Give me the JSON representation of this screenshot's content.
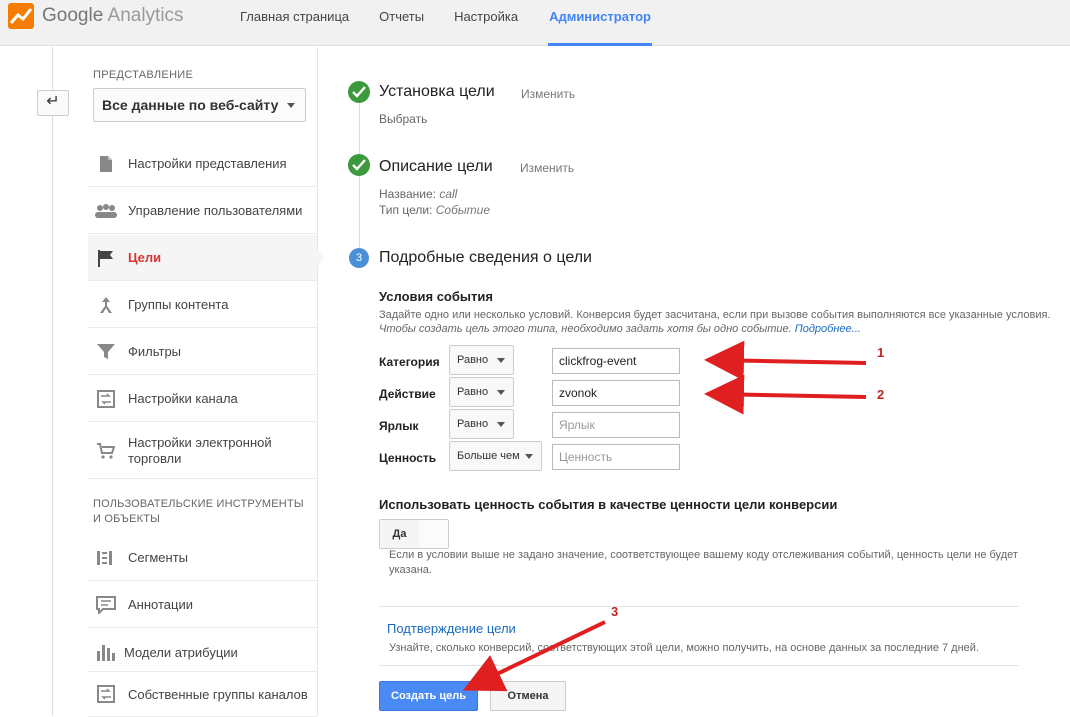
{
  "header": {
    "logo_google": "Google",
    "logo_analytics": "Analytics",
    "nav": [
      "Главная страница",
      "Отчеты",
      "Настройка",
      "Администратор"
    ]
  },
  "sidebar": {
    "view_label": "ПРЕДСТАВЛЕНИЕ",
    "view_select": "Все данные по веб-сайту",
    "items": [
      {
        "label": "Настройки представления",
        "icon": "page-icon"
      },
      {
        "label": "Управление пользователями",
        "icon": "people-icon"
      },
      {
        "label": "Цели",
        "icon": "flag-icon"
      },
      {
        "label": "Группы контента",
        "icon": "branch-icon"
      },
      {
        "label": "Фильтры",
        "icon": "filter-icon"
      },
      {
        "label": "Настройки канала",
        "icon": "channel-icon"
      },
      {
        "label": "Настройки электронной торговли",
        "icon": "cart-icon"
      }
    ],
    "tools_title": "ПОЛЬЗОВАТЕЛЬСКИЕ ИНСТРУМЕНТЫ И ОБЪЕКТЫ",
    "tools": [
      {
        "label": "Сегменты",
        "icon": "segments-icon"
      },
      {
        "label": "Аннотации",
        "icon": "annotation-icon"
      },
      {
        "label": "Модели атрибуции",
        "icon": "bars-icon"
      },
      {
        "label": "Собственные группы каналов",
        "icon": "channel-groups-icon"
      }
    ]
  },
  "steps": {
    "s1_title": "Установка цели",
    "s1_edit": "Изменить",
    "s1_value": "Выбрать",
    "s2_title": "Описание цели",
    "s2_edit": "Изменить",
    "s2_name_label": "Название:",
    "s2_name_value": "call",
    "s2_type_label": "Тип цели:",
    "s2_type_value": "Событие",
    "s3_num": "3",
    "s3_title": "Подробные сведения о цели"
  },
  "conditions": {
    "title": "Условия события",
    "desc": "Задайте одно или несколько условий. Конверсия будет засчитана, если при вызове события выполняются все указанные условия.",
    "desc_italic": "Чтобы создать цель этого типа, необходимо задать хотя бы одно событие.",
    "more_link": "Подробнее...",
    "rows": [
      {
        "label": "Категория",
        "op": "Равно",
        "value": "clickfrog-event",
        "placeholder": ""
      },
      {
        "label": "Действие",
        "op": "Равно",
        "value": "zvonok",
        "placeholder": ""
      },
      {
        "label": "Ярлык",
        "op": "Равно",
        "value": "",
        "placeholder": "Ярлык"
      },
      {
        "label": "Ценность",
        "op": "Больше чем",
        "value": "",
        "placeholder": "Ценность"
      }
    ]
  },
  "use_value": {
    "title": "Использовать ценность события в качестве ценности цели конверсии",
    "toggle_label": "Да",
    "desc": "Если в условии выше не задано значение, соответствующее вашему коду отслеживания событий, ценность цели не будет указана."
  },
  "verify": {
    "link": "Подтверждение цели",
    "desc": "Узнайте, сколько конверсий, соответствующих этой цели, можно получить, на основе данных за последние 7 дней."
  },
  "actions": {
    "create": "Создать цель",
    "cancel": "Отмена"
  },
  "annotations": [
    "1",
    "2",
    "3"
  ],
  "colors": {
    "accent": "#4285f4",
    "check_green": "#3c9a3c",
    "active_red": "#dd3333",
    "arrow_red": "#e02020",
    "create_button": "#4a8af4"
  }
}
